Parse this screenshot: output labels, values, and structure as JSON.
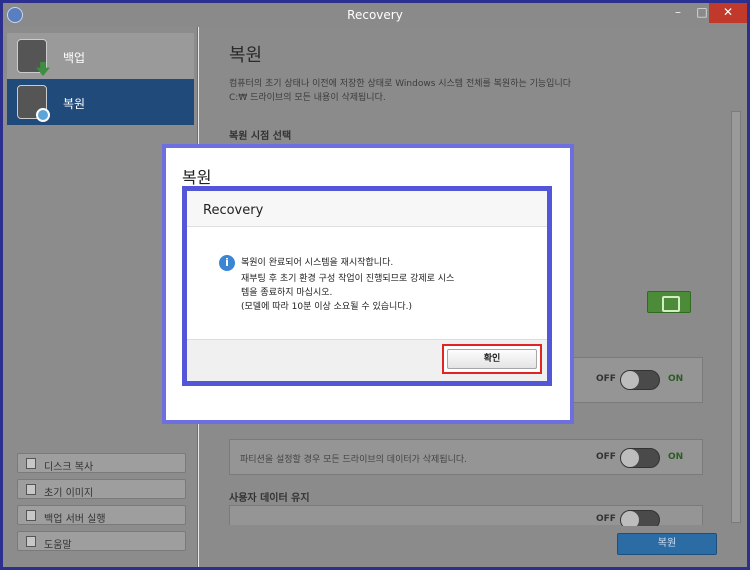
{
  "window": {
    "title": "Recovery",
    "min_glyph": "–",
    "max_glyph": "□",
    "close_glyph": "✕"
  },
  "sidebar": {
    "nav": [
      {
        "label": "백업",
        "icon": "backup-drive-icon"
      },
      {
        "label": "복원",
        "icon": "restore-drive-icon"
      }
    ],
    "buttons": [
      {
        "label": "디스크 복사",
        "icon": "disk-copy-icon"
      },
      {
        "label": "초기 이미지",
        "icon": "initial-image-icon"
      },
      {
        "label": "백업 서버 실행",
        "icon": "backup-server-icon"
      },
      {
        "label": "도움말",
        "icon": "help-icon"
      }
    ]
  },
  "main": {
    "heading": "복원",
    "desc_line1": "컴퓨터의 초기 상태나 이전에 저장한 상태로 Windows 시스템 전체를 복원하는 기능입니다",
    "desc_line2": "C:₩ 드라이브의 모든 내용이 삭제됩니다.",
    "section_restore_point": "복원 시점 선택",
    "partition_text": "파티션을 설정할 경우 모든 드라이브의 데이터가 삭제됩니다.",
    "section_user_data": "사용자 데이터 유지",
    "toggle_off": "OFF",
    "toggle_on": "ON",
    "restore_button": "복원"
  },
  "dialog_outer": {
    "title": "복원"
  },
  "dialog_inner": {
    "title": "Recovery",
    "info_glyph": "i",
    "msg1": "복원이 완료되어 시스템을 재시작합니다.",
    "msg2": "재부팅 후 초기 환경 구성 작업이 진행되므로 강제로 시스",
    "msg3": "템을 종료하지 마십시오.",
    "msg4": "(모델에 따라 10분 이상 소요될 수 있습니다.)",
    "ok_label": "확인"
  },
  "colors": {
    "dialog_border": "#5456d8",
    "highlight": "#e02424",
    "accent_green": "#4c8b37",
    "accent_blue": "#2b6ca5"
  }
}
